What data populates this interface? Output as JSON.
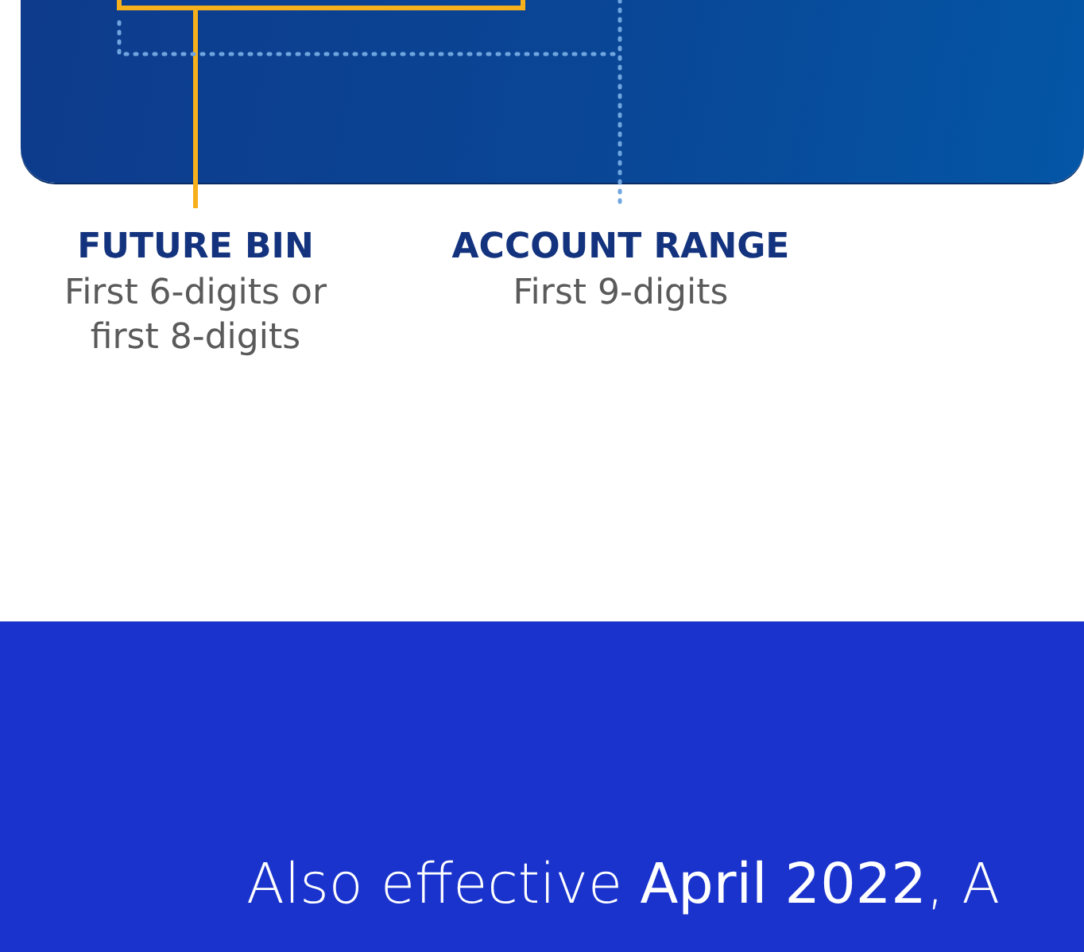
{
  "card_labels": [
    {
      "title": "FUTURE BIN",
      "description": "First 6-digits or first 8-digits"
    },
    {
      "title": "ACCOUNT RANGE",
      "description": "First 9-digits"
    }
  ],
  "banner": {
    "text": "Also effective **April 2022**, A"
  }
}
